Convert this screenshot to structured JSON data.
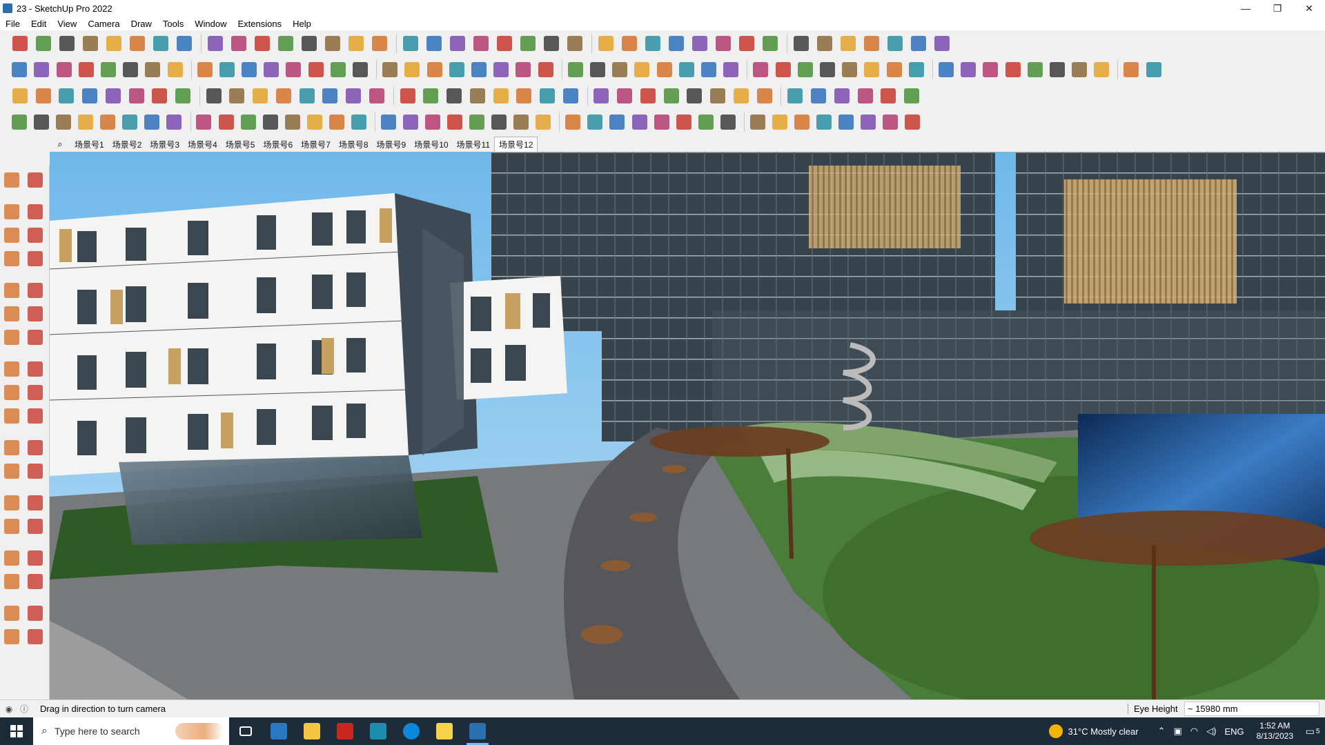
{
  "window": {
    "title": "23 - SketchUp Pro 2022",
    "minimize": "—",
    "maximize": "❐",
    "close": "✕"
  },
  "menu": [
    "File",
    "Edit",
    "View",
    "Camera",
    "Draw",
    "Tools",
    "Window",
    "Extensions",
    "Help"
  ],
  "scene_tabs": {
    "search_icon": "⌕",
    "tabs": [
      "场景号1",
      "场景号2",
      "场景号3",
      "场景号4",
      "场景号5",
      "场景号6",
      "场景号7",
      "场景号8",
      "场景号9",
      "场景号10",
      "场景号11",
      "场景号12"
    ],
    "active_index": 11
  },
  "status": {
    "message": "Drag in direction to turn camera",
    "eye_height_label": "Eye Height",
    "eye_height_value": "~ 15980 mm"
  },
  "taskbar": {
    "search_placeholder": "Type here to search",
    "weather": "31°C  Mostly clear",
    "language": "ENG",
    "time": "1:52 AM",
    "date": "8/13/2023",
    "notification_count": "5"
  },
  "colors": {
    "sky": "#8ec9ef",
    "facade": "#f4f4f2",
    "glass": "#3d4a55",
    "wood": "#c8a060",
    "lawn": "#2f5a25",
    "road": "#55575a",
    "taskbar": "#1c2a3a"
  }
}
